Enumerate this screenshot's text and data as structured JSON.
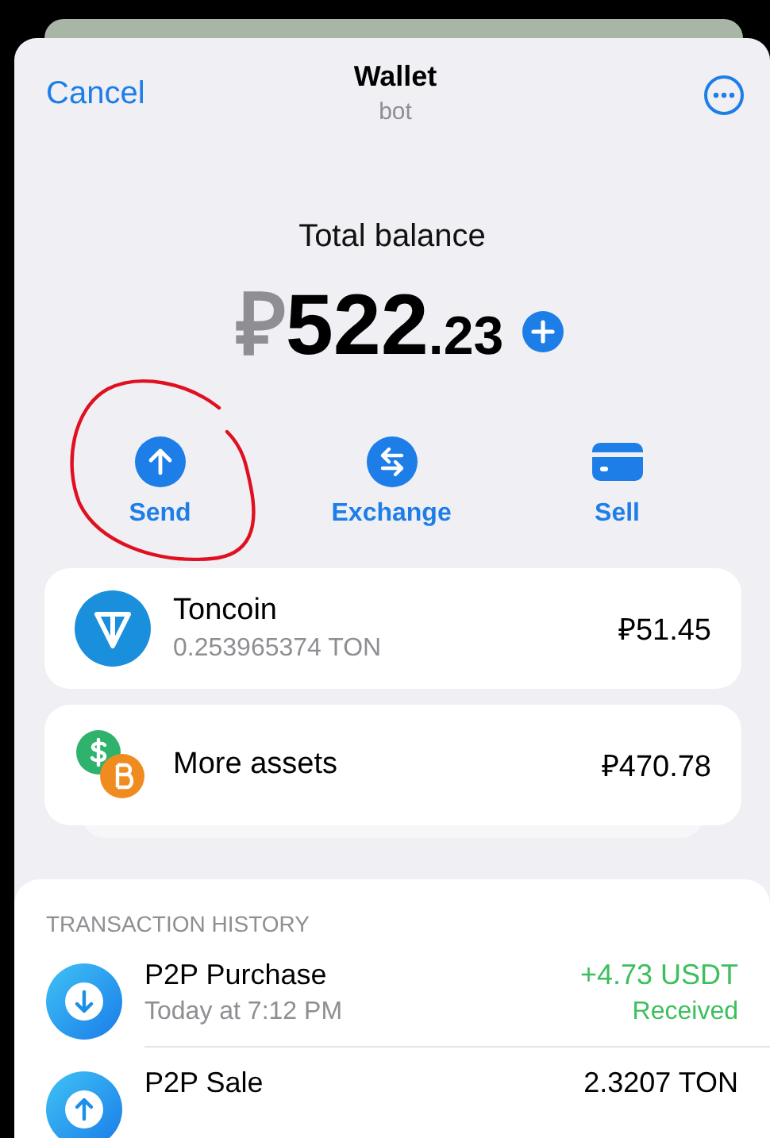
{
  "header": {
    "cancel": "Cancel",
    "title": "Wallet",
    "subtitle": "bot"
  },
  "balance": {
    "label": "Total balance",
    "currency": "₽",
    "integer": "522",
    "fraction": ".23"
  },
  "actions": [
    {
      "kind": "send",
      "label": "Send"
    },
    {
      "kind": "exchange",
      "label": "Exchange"
    },
    {
      "kind": "sell",
      "label": "Sell"
    }
  ],
  "assets": [
    {
      "kind": "ton",
      "name": "Toncoin",
      "amount": "0.253965374 TON",
      "value": "₽51.45"
    },
    {
      "kind": "more",
      "name": "More assets",
      "value": "₽470.78"
    }
  ],
  "history": {
    "heading": "TRANSACTION HISTORY",
    "rows": [
      {
        "kind": "in",
        "title": "P2P Purchase",
        "time": "Today at 7:12 PM",
        "amount": "+4.73 USDT",
        "status": "Received"
      },
      {
        "kind": "out",
        "title": "P2P Sale",
        "amount": "2.3207 TON"
      }
    ]
  }
}
